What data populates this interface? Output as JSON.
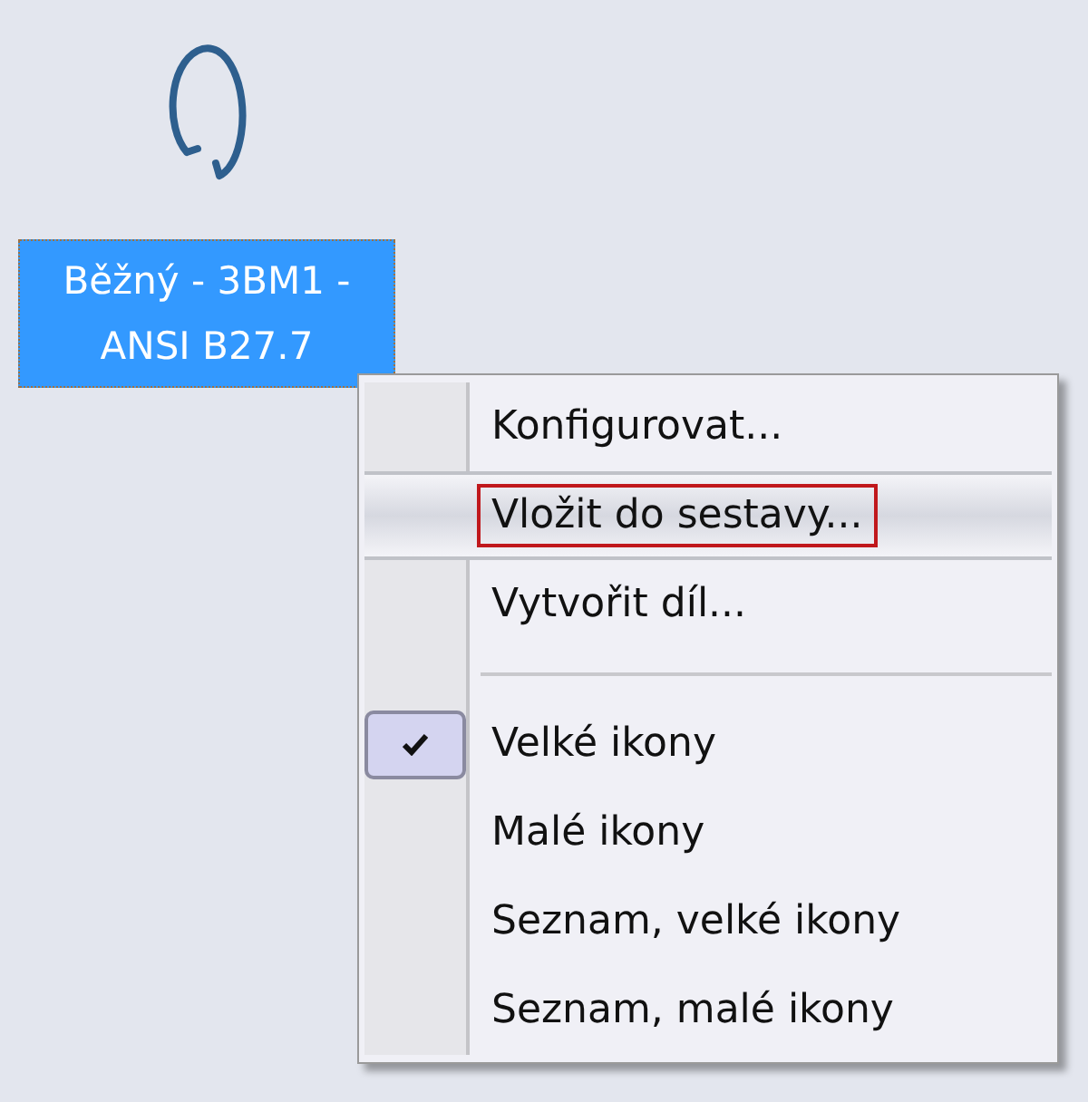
{
  "thumbnail": {
    "label": "Běžný - 3BM1 - ANSI B27.7",
    "selected": true
  },
  "context_menu": {
    "items": [
      {
        "kind": "command",
        "label": "Konfigurovat...",
        "highlighted": false
      },
      {
        "kind": "command",
        "label": "Vložit do sestavy...",
        "highlighted": true
      },
      {
        "kind": "command",
        "label": "Vytvořit díl...",
        "highlighted": false
      },
      {
        "kind": "separator"
      },
      {
        "kind": "option",
        "label": "Velké ikony",
        "checked": true
      },
      {
        "kind": "option",
        "label": "Malé ikony",
        "checked": false
      },
      {
        "kind": "option",
        "label": "Seznam, velké ikony",
        "checked": false
      },
      {
        "kind": "option",
        "label": "Seznam, malé ikony",
        "checked": false
      }
    ]
  }
}
